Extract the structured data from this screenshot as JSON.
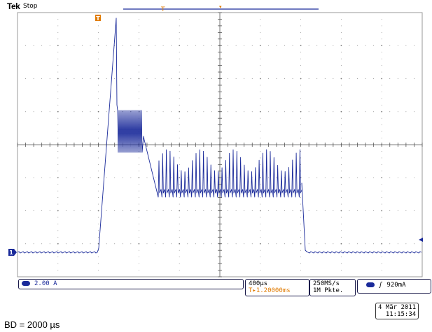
{
  "header": {
    "brand": "Tek",
    "state": "Stop"
  },
  "markers": {
    "trigger_pos": "T",
    "ch1_ref": "1"
  },
  "status": {
    "ch1_scale": "2.00 A",
    "timebase": "400µs",
    "trigger_position_value": "1.20000ms",
    "sample_rate": "250MS/s",
    "record_length": "1M Pkte.",
    "trigger_channel": "1",
    "trigger_level": "920mA"
  },
  "datetime": {
    "date": "4 Mär 2011",
    "time": "11:15:34"
  },
  "footnote": "BD = 2000 µs",
  "colors": {
    "trace": "#1a2a9a",
    "grid": "#777777",
    "marker": "#e07a00",
    "panel_border": "#1a1a4a"
  }
}
